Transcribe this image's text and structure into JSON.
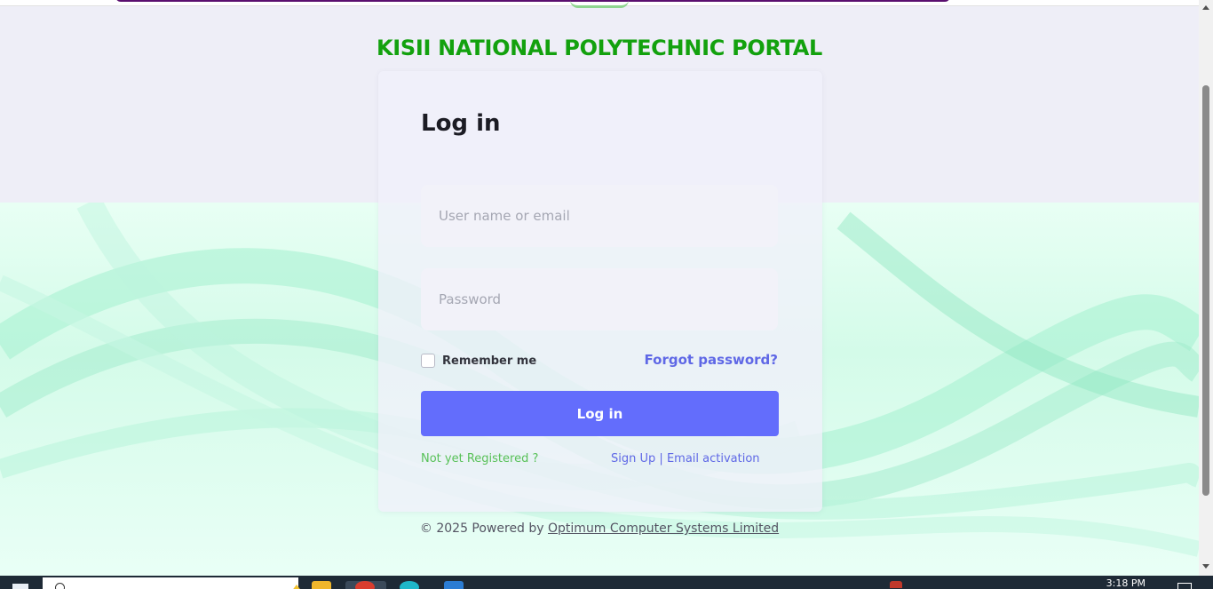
{
  "header": {
    "portal_title": "KISII NATIONAL POLYTECHNIC PORTAL"
  },
  "login": {
    "title": "Log in",
    "username_placeholder": "User name or email",
    "password_placeholder": "Password",
    "remember_label": "Remember me",
    "forgot_label": "Forgot password?",
    "submit_label": "Log in",
    "not_registered": "Not yet Registered ?",
    "signup_label": "Sign Up",
    "separator": "|",
    "email_activation_label": "Email activation"
  },
  "footer": {
    "copyright": "© 2025 Powered by",
    "company_link": "Optimum Computer Systems Limited"
  },
  "taskbar": {
    "time": "3:18 PM",
    "icons": [
      "start-icon",
      "search-icon",
      "file-explorer-icon",
      "chrome-icon",
      "edge-icon",
      "word-icon",
      "notification-icon"
    ]
  },
  "colors": {
    "title_green": "#13a10e",
    "primary_button": "#636dfc",
    "link_blue": "#5f68e6",
    "hint_green": "#58c158",
    "purple_bar": "#5a0f6e"
  }
}
